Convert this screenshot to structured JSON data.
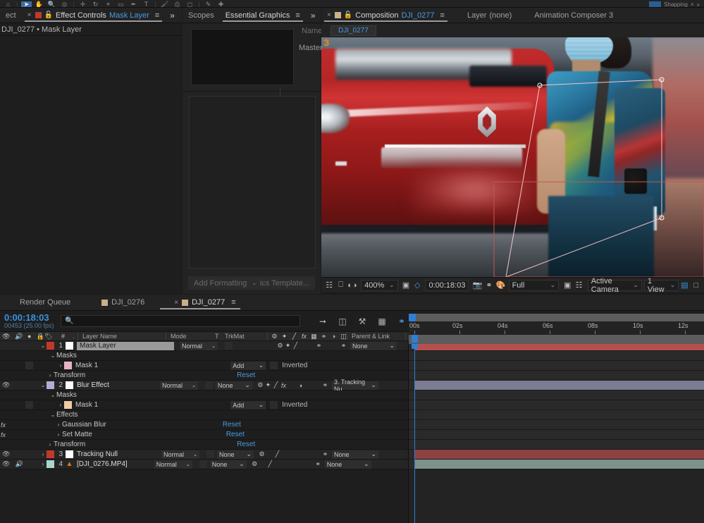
{
  "toolbar": {
    "workspace_label": "Shapping",
    "tools": [
      "home-icon",
      "selection-tool",
      "hand-tool",
      "zoom-tool",
      "orbit-tool",
      "pan-tool",
      "rotation-tool",
      "anchor-point-tool",
      "shape-tool",
      "pen-tool",
      "type-tool",
      "brush-tool",
      "clone-stamp-tool",
      "eraser-tool",
      "roto-brush-tool",
      "puppet-tool"
    ]
  },
  "effect_controls": {
    "tabs": [
      {
        "label": "ect",
        "active": false
      },
      {
        "label": "Effect Controls",
        "value": "Mask Layer",
        "active": true
      }
    ],
    "breadcrumb": "DJI_0277 • Mask Layer",
    "close_x": "×",
    "menu_icon": "≡",
    "overflow_icon": "»",
    "swatch_color": "#c0392b"
  },
  "essential_graphics": {
    "tabs": [
      {
        "label": "Scopes",
        "active": false
      },
      {
        "label": "Essential Graphics",
        "active": true
      }
    ],
    "menu_icon": "≡",
    "overflow_icon": "»",
    "name_label": "Name",
    "master_label": "Master",
    "footer_left": "Add Formatting",
    "footer_right": "ics Template...",
    "footer_chevron": "⌄"
  },
  "composition": {
    "tabs": [
      {
        "label": "Composition",
        "value": "DJI_0277",
        "active": true
      },
      {
        "label": "Layer",
        "value": "(none)",
        "active": false
      },
      {
        "label": "Animation Composer 3",
        "active": false
      }
    ],
    "close_x": "×",
    "menu_icon": "≡",
    "swatch_color": "#c9b089",
    "breadcrumb_chip": "DJI_0277",
    "viewer_badge": "3",
    "toolbar": {
      "magnification": "400%",
      "timecode": "0:00:18:03",
      "resolution": "Full",
      "camera": "Active Camera",
      "views": "1 View",
      "icons": [
        "always-preview-icon",
        "monitor-icon",
        "3d-glasses-icon",
        "region-of-interest-icon",
        "grid-guides-icon",
        "snapshot-camera-icon",
        "show-snapshot-icon",
        "channel-rgb-icon",
        "transparency-grid-icon",
        "mask-view-icon",
        "timeline-toggle-icon"
      ],
      "dropdown_chevron": "⌄"
    }
  },
  "timeline": {
    "tabs": [
      {
        "label": "Render Queue",
        "active": false,
        "has_swatch": false
      },
      {
        "label": "DJI_0276",
        "active": false,
        "has_swatch": true
      },
      {
        "label": "DJI_0277",
        "active": true,
        "has_swatch": true
      }
    ],
    "close_x": "×",
    "menu_icon": "≡",
    "current_time": "0:00:18:03",
    "frame_info": "00453 (25.00 fps)",
    "search_icon": "search-icon",
    "search_value": "",
    "switch_icons": [
      "composition-mini-flowchart-icon",
      "draft-3d-icon",
      "hide-shy-layers-icon",
      "frame-blending-icon",
      "motion-blur-icon",
      "graph-editor-icon"
    ],
    "columns": [
      "Layer Name",
      "Mode",
      "T",
      "TrkMat",
      "Parent & Link"
    ],
    "column_icons": [
      "video-icon",
      "audio-icon",
      "solo-icon",
      "lock-icon",
      "label-icon",
      "number-icon"
    ],
    "switch_header_icons": [
      "shy-icon",
      "collapse-icon",
      "quality-icon",
      "fx-icon",
      "frame-blend-icon",
      "motion-blur-icon",
      "adjustment-icon",
      "3d-icon"
    ],
    "ruler_ticks": [
      "00s",
      "02s",
      "04s",
      "06s",
      "08s",
      "10s",
      "12s"
    ],
    "rows": [
      {
        "type": "layer",
        "selected": true,
        "num": "1",
        "name": "Mask Layer",
        "color": "#c0392b",
        "mode": "Normal",
        "trkmat": "",
        "parent": "None",
        "bar_color": "#b55050",
        "video": true,
        "audio": true,
        "expanded": true,
        "name_editing": true
      },
      {
        "type": "group",
        "label": "Masks",
        "indent": 70,
        "expanded": true
      },
      {
        "type": "mask",
        "label": "Mask 1",
        "indent": 82,
        "color": "#e5b4c0",
        "mode": "Add",
        "inverted": "Inverted"
      },
      {
        "type": "group",
        "label": "Transform",
        "indent": 78,
        "reset": "Reset",
        "expanded": false
      },
      {
        "type": "layer",
        "selected": false,
        "num": "2",
        "name": "Blur Effect",
        "color": "#b0aed6",
        "mode": "Normal",
        "trkmat": "None",
        "parent": "3. Tracking Nu",
        "bar_color": "#7c7c94",
        "video": true,
        "audio": false,
        "expanded": true
      },
      {
        "type": "group",
        "label": "Masks",
        "indent": 70,
        "expanded": true
      },
      {
        "type": "mask",
        "label": "Mask 1",
        "indent": 82,
        "color": "#f0cba4",
        "mode": "Add",
        "inverted": "Inverted"
      },
      {
        "type": "group",
        "label": "Effects",
        "indent": 70,
        "expanded": true
      },
      {
        "type": "effect",
        "label": "Gaussian Blur",
        "indent": 82,
        "reset": "Reset",
        "fx": "fx"
      },
      {
        "type": "effect",
        "label": "Set Matte",
        "indent": 82,
        "reset": "Reset",
        "fx": "fx"
      },
      {
        "type": "group",
        "label": "Transform",
        "indent": 78,
        "reset": "Reset",
        "expanded": false
      },
      {
        "type": "layer",
        "selected": false,
        "num": "3",
        "name": "Tracking Null",
        "color": "#c0392b",
        "mode": "Normal",
        "trkmat": "None",
        "parent": "None",
        "bar_color": "#8e4141",
        "video": true,
        "audio": false,
        "expanded": false
      },
      {
        "type": "layer",
        "selected": false,
        "num": "4",
        "name": "[DJI_0276.MP4]",
        "color": "#a8d6ce",
        "mode": "Normal",
        "trkmat": "None",
        "parent": "None",
        "bar_color": "#7d918d",
        "video": true,
        "audio": true,
        "expanded": false,
        "icon": "video-file-icon"
      }
    ]
  },
  "colors": {
    "accent_blue": "#3a93dd",
    "link_blue": "#4a9ae0",
    "panel_bg": "#1e1e1e",
    "tabbar_bg": "#232323",
    "selection": "#3a3a3a"
  }
}
